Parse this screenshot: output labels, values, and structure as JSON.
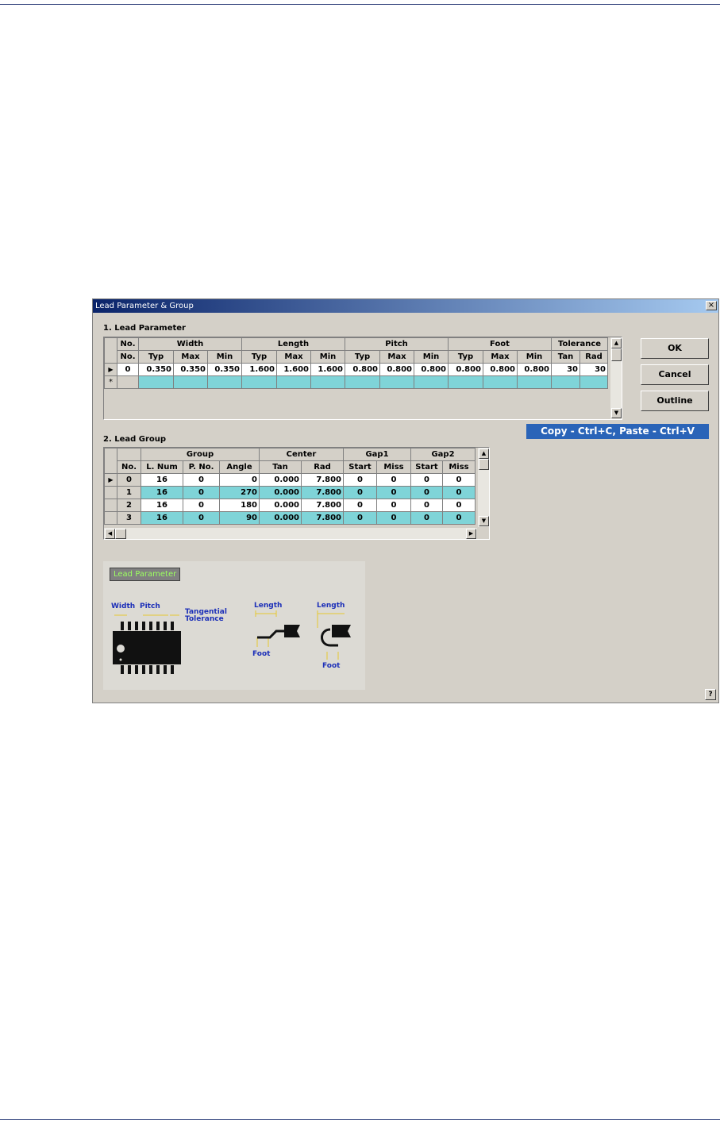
{
  "window": {
    "title": "Lead Parameter & Group",
    "close_glyph": "×",
    "help_glyph": "?"
  },
  "section1": {
    "label": "1. Lead Parameter",
    "group_headers": [
      "No.",
      "Width",
      "Length",
      "Pitch",
      "Foot",
      "Tolerance"
    ],
    "sub_headers": [
      "No.",
      "Typ",
      "Max",
      "Min",
      "Typ",
      "Max",
      "Min",
      "Typ",
      "Max",
      "Min",
      "Typ",
      "Max",
      "Min",
      "Tan",
      "Rad"
    ],
    "rows": [
      [
        "0",
        "0.350",
        "0.350",
        "0.350",
        "1.600",
        "1.600",
        "1.600",
        "0.800",
        "0.800",
        "0.800",
        "0.800",
        "0.800",
        "0.800",
        "30",
        "30"
      ]
    ],
    "new_row_marker": "*"
  },
  "buttons": {
    "ok": "OK",
    "cancel": "Cancel",
    "outline": "Outline"
  },
  "copy_hint": "Copy - Ctrl+C, Paste - Ctrl+V",
  "section2": {
    "label": "2. Lead Group",
    "group_headers": [
      "Group",
      "Center",
      "Gap1",
      "Gap2"
    ],
    "sub_headers": [
      "No.",
      "L. Num",
      "P. No.",
      "Angle",
      "Tan",
      "Rad",
      "Start",
      "Miss",
      "Start",
      "Miss"
    ],
    "rows": [
      [
        "0",
        "16",
        "0",
        "0",
        "0.000",
        "7.800",
        "0",
        "0",
        "0",
        "0"
      ],
      [
        "1",
        "16",
        "0",
        "270",
        "0.000",
        "7.800",
        "0",
        "0",
        "0",
        "0"
      ],
      [
        "2",
        "16",
        "0",
        "180",
        "0.000",
        "7.800",
        "0",
        "0",
        "0",
        "0"
      ],
      [
        "3",
        "16",
        "0",
        "90",
        "0.000",
        "7.800",
        "0",
        "0",
        "0",
        "0"
      ]
    ]
  },
  "diagram": {
    "title": "Lead Parameter",
    "labels": {
      "width": "Width",
      "pitch": "Pitch",
      "tangential": "Tangential",
      "tolerance": "Tolerance",
      "length1": "Length",
      "foot1": "Foot",
      "length2": "Length",
      "foot2": "Foot"
    }
  }
}
